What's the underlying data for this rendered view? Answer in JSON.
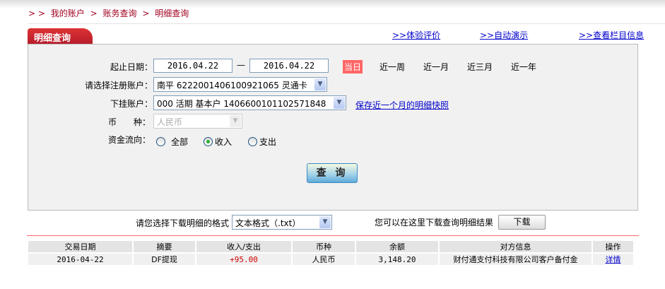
{
  "breadcrumb": {
    "prefix": "> >",
    "items": [
      "我的账户",
      "账务查询",
      "明细查询"
    ],
    "sep": ">"
  },
  "tab": {
    "label": "明细查询"
  },
  "top_links": [
    ">>体验评价",
    ">>自动演示",
    ">>查看栏目信息"
  ],
  "form": {
    "date_label": "起止日期：",
    "start_date": "2016.04.22",
    "date_sep": "—",
    "end_date": "2016.04.22",
    "quick_ranges": [
      "当日",
      "近一周",
      "近一月",
      "近三月",
      "近一年"
    ],
    "active_range": "当日",
    "account_label": "请选择注册账户：",
    "account_value": "南平 6222001406100921065 灵通卡",
    "sub_account_label": "下挂账户：",
    "sub_account_value": "000 活期 基本户 1406600101102571848",
    "snapshot_link": "保存近一个月的明细快照",
    "currency_label": "币　　种：",
    "currency_value": "人民币",
    "flow_label": "资金流向：",
    "flow_options": [
      "全部",
      "收入",
      "支出"
    ],
    "flow_selected": "收入",
    "query_button": "查 询"
  },
  "download": {
    "format_label": "请您选择下载明细的格式",
    "format_value": "文本格式（.txt）",
    "hint": "您可以在这里下载查询明细结果",
    "button": "下载"
  },
  "table": {
    "headers": [
      "交易日期",
      "摘要",
      "收入/支出",
      "币种",
      "余额",
      "对方信息",
      "操作"
    ],
    "rows": [
      [
        "2016-04-22",
        "DF提现",
        "+95.00",
        "人民币",
        "3,148.20",
        "财付通支付科技有限公司客户备付金",
        "详情"
      ]
    ]
  },
  "colors": {
    "brand": "#b81c2c",
    "accent": "#ff6666",
    "link": "#0000cc"
  }
}
